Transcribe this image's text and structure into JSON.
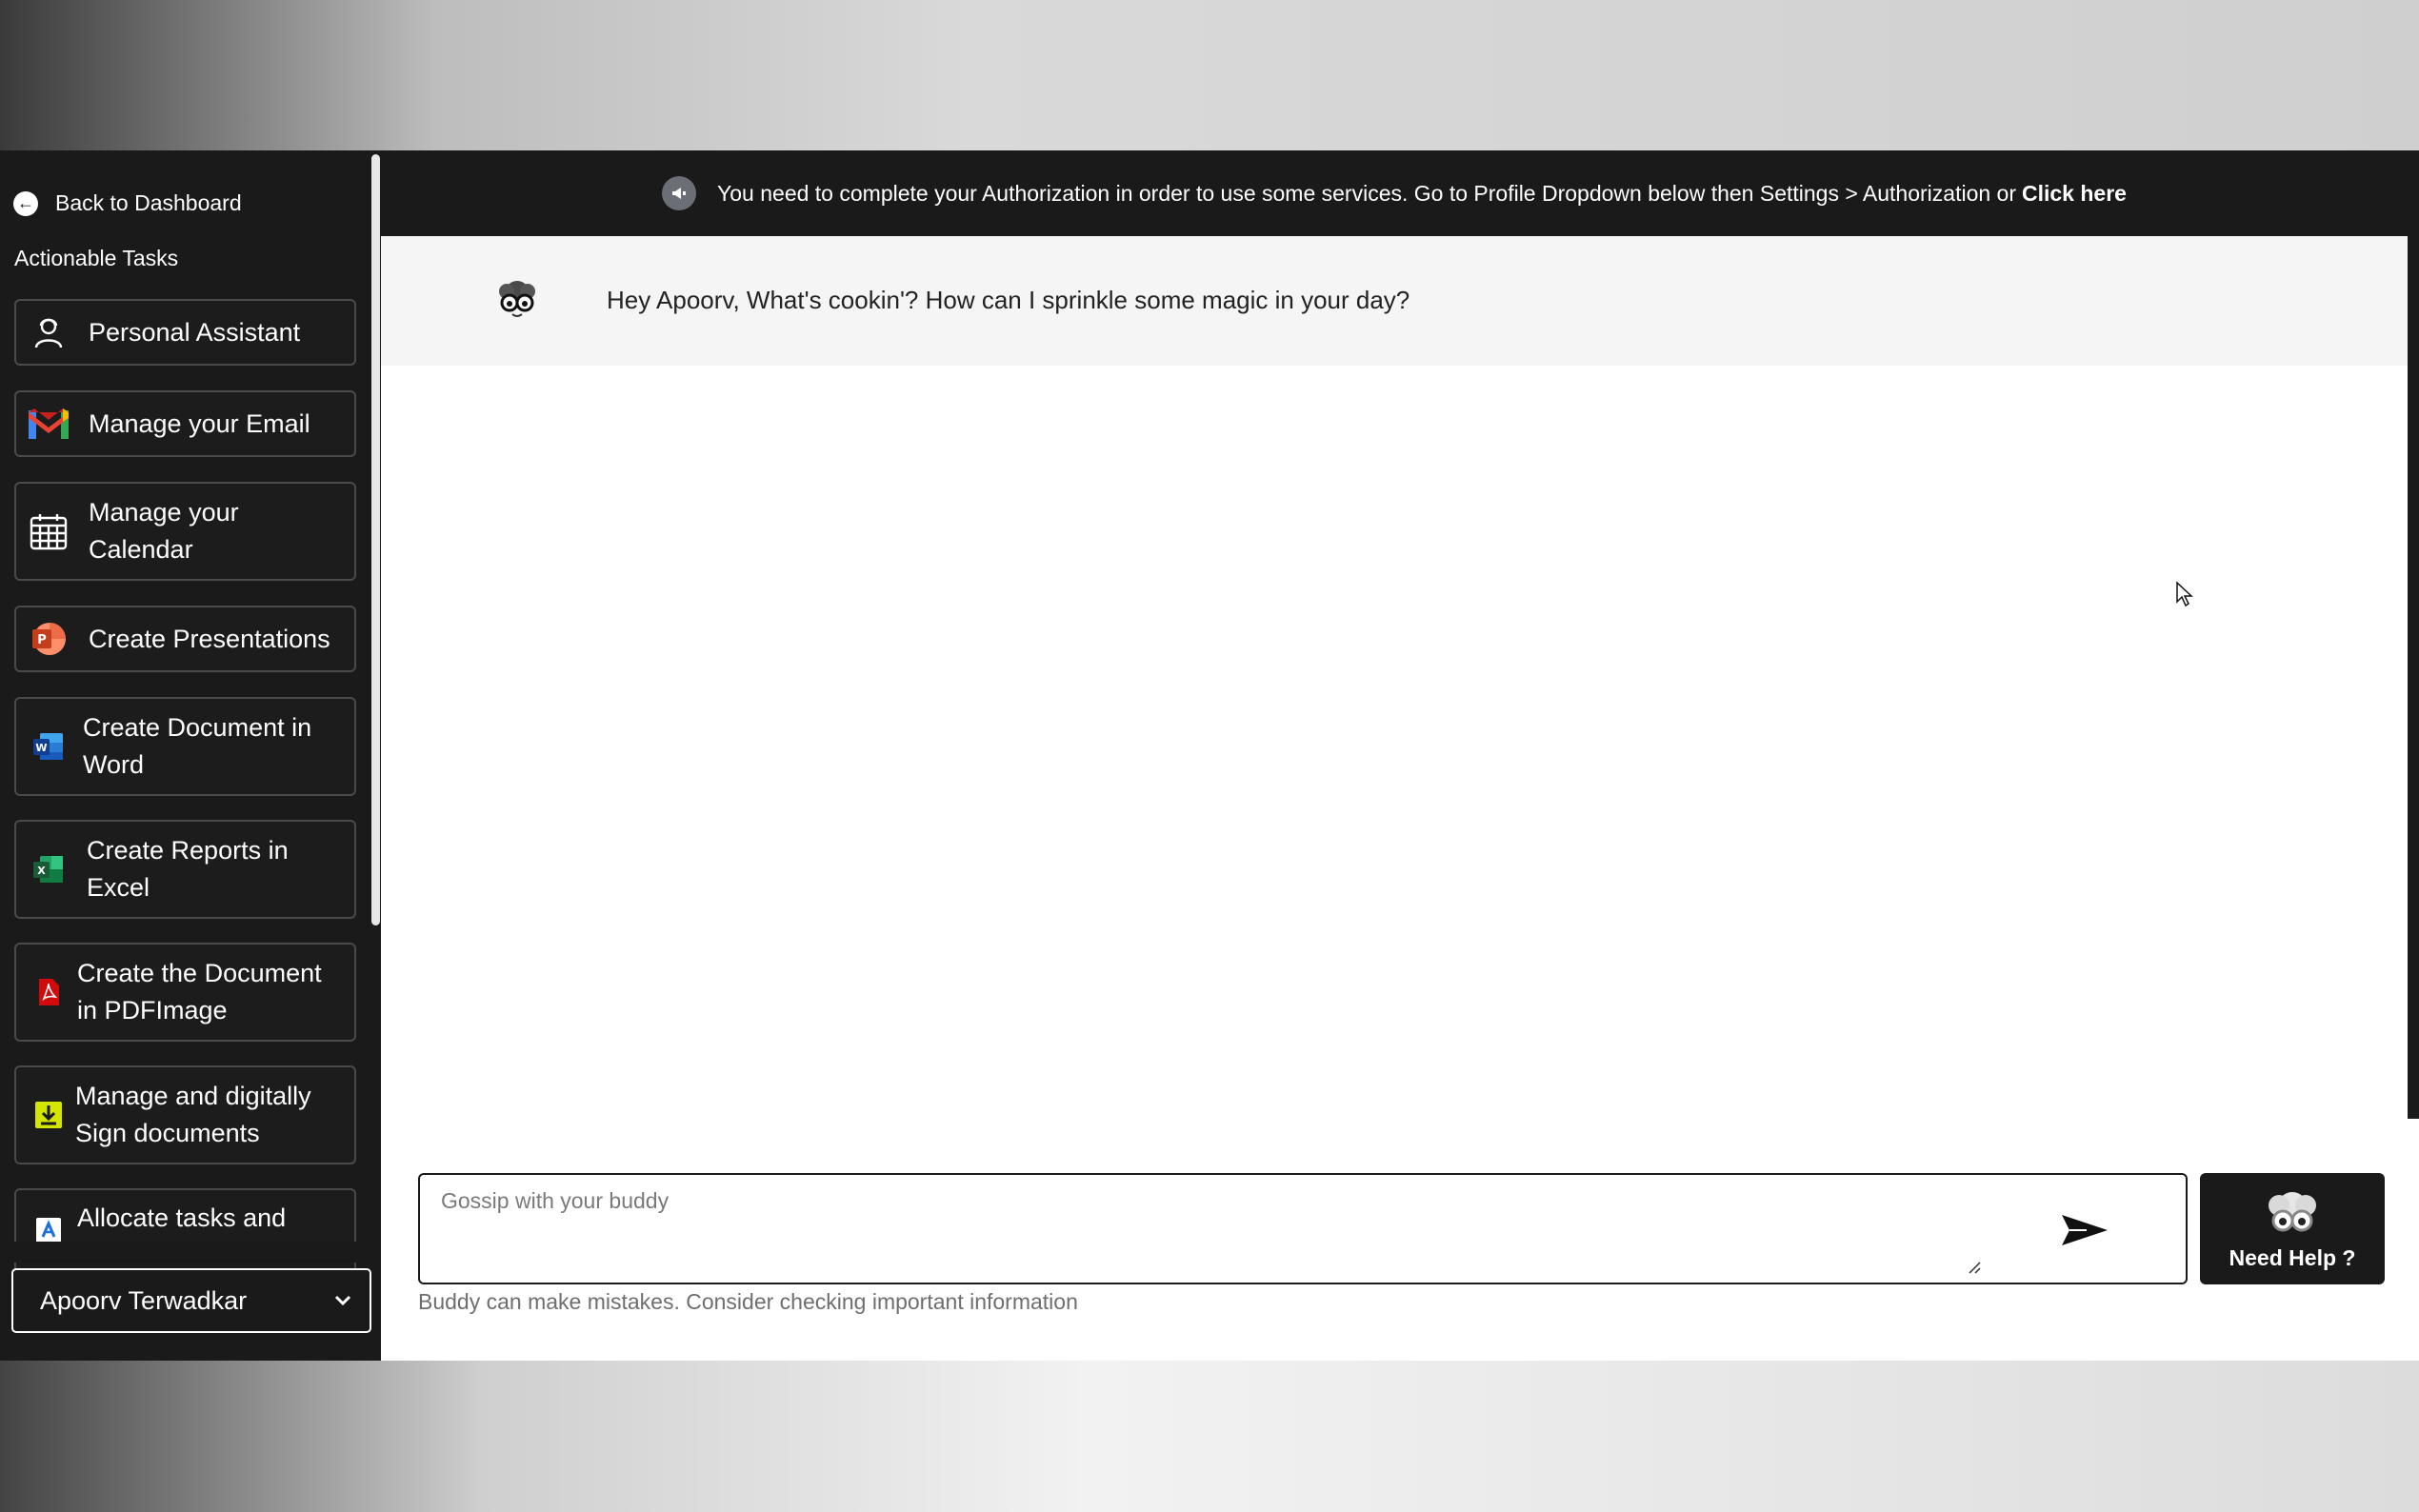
{
  "sidebar": {
    "back_label": "Back to Dashboard",
    "section_title": "Actionable Tasks",
    "tasks": [
      {
        "label": "Personal Assistant",
        "icon": "person-assistant-icon"
      },
      {
        "label": "Manage your Email",
        "icon": "gmail-icon"
      },
      {
        "label": "Manage your Calendar",
        "icon": "calendar-icon"
      },
      {
        "label": "Create Presentations",
        "icon": "powerpoint-icon"
      },
      {
        "label": "Create Document in Word",
        "icon": "word-icon"
      },
      {
        "label": "Create Reports in Excel",
        "icon": "excel-icon"
      },
      {
        "label": "Create the Document in PDFImage",
        "icon": "pdf-icon"
      },
      {
        "label": "Manage and digitally Sign documents",
        "icon": "download-sign-icon"
      },
      {
        "label": "Allocate tasks and",
        "icon": "task-allocate-icon"
      }
    ],
    "user_name": "Apoorv Terwadkar"
  },
  "banner": {
    "text": "You need to complete your Authorization in order to use some services. Go to Profile Dropdown below then Settings > Authorization or",
    "link": "Click here"
  },
  "greeting": {
    "message": "Hey Apoorv, What's cookin'? How can I sprinkle some magic in your day?"
  },
  "composer": {
    "placeholder": "Gossip with your buddy",
    "disclaimer": "Buddy can make mistakes. Consider checking important information"
  },
  "help": {
    "label": "Need Help ?"
  },
  "colors": {
    "sidebar_bg": "#1a1a1a",
    "gmail_red": "#ea4335",
    "powerpoint": "#d04423",
    "word": "#2b579a",
    "excel": "#1d6f42",
    "pdf": "#d10b0b",
    "sign": "#d4e600"
  }
}
